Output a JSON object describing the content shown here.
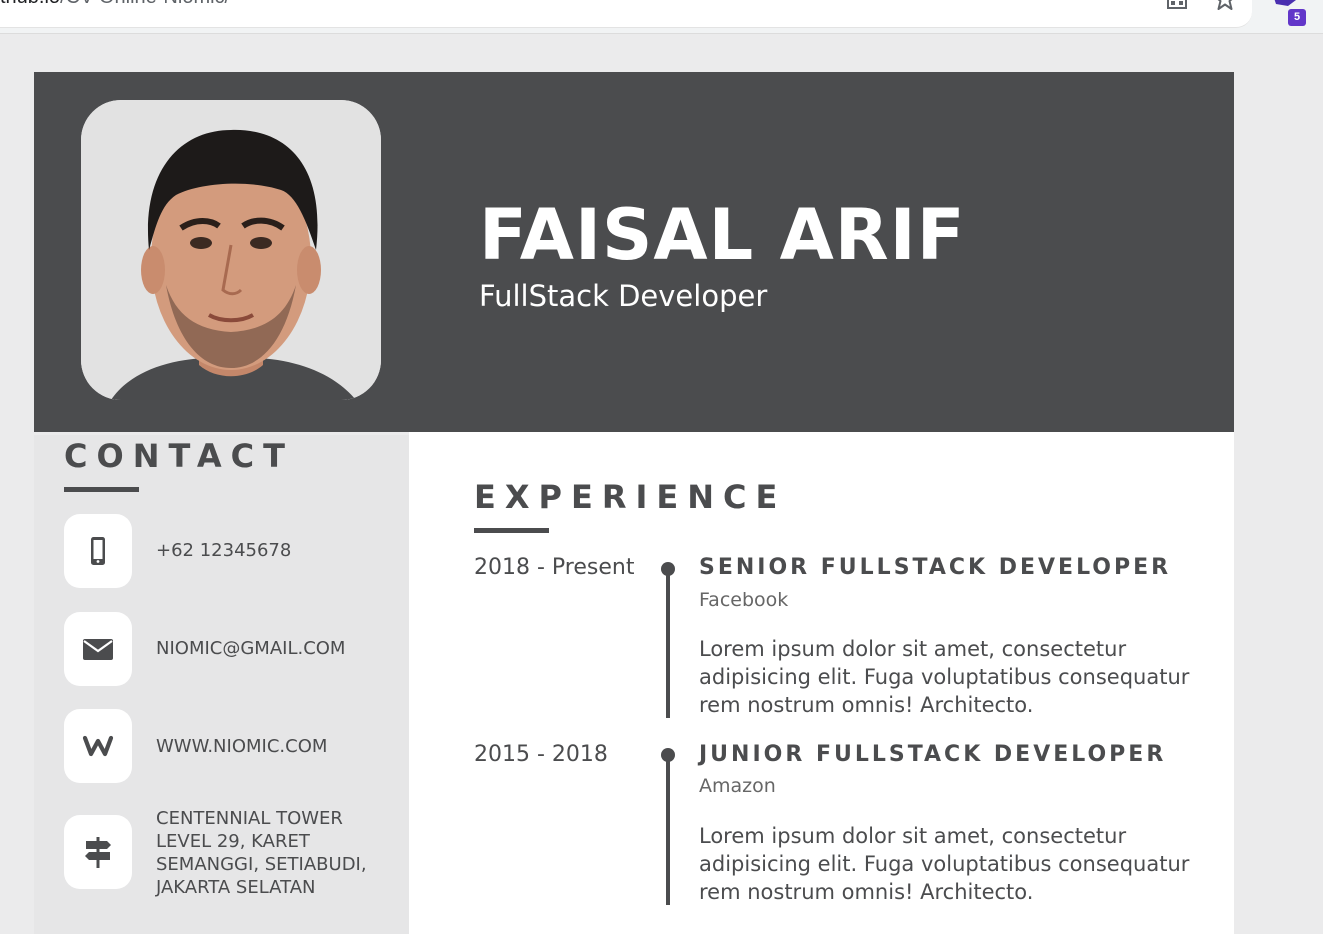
{
  "browser": {
    "url_host": "thub.io",
    "url_path": "/CV-Online-Niomic/",
    "extension_badge": "5"
  },
  "profile": {
    "name": "FAISAL ARIF",
    "role": "FullStack Developer"
  },
  "contact": {
    "title": "CONTACT",
    "phone": "+62 12345678",
    "email": "NIOMIC@GMAIL.COM",
    "website": "WWW.NIOMIC.COM",
    "address_lines": [
      "CENTENNIAL TOWER",
      "LEVEL 29, KARET",
      "SEMANGGI, SETIABUDI,",
      "JAKARTA SELATAN"
    ]
  },
  "experience": {
    "title": "EXPERIENCE",
    "items": [
      {
        "period": "2018 - Present",
        "title": "SENIOR FULLSTACK DEVELOPER",
        "company": "Facebook",
        "description": "Lorem ipsum dolor sit amet, consectetur adipisicing elit. Fuga voluptatibus consequatur rem nostrum omnis! Architecto."
      },
      {
        "period": "2015 - 2018",
        "title": "JUNIOR FULLSTACK DEVELOPER",
        "company": "Amazon",
        "description": "Lorem ipsum dolor sit amet, consectetur adipisicing elit. Fuga voluptatibus consequatur rem nostrum omnis! Architecto."
      }
    ]
  },
  "colors": {
    "header_bg": "#4b4c4e",
    "sidebar_bg": "#e6e6e7",
    "text_dark": "#4b4c4e"
  }
}
